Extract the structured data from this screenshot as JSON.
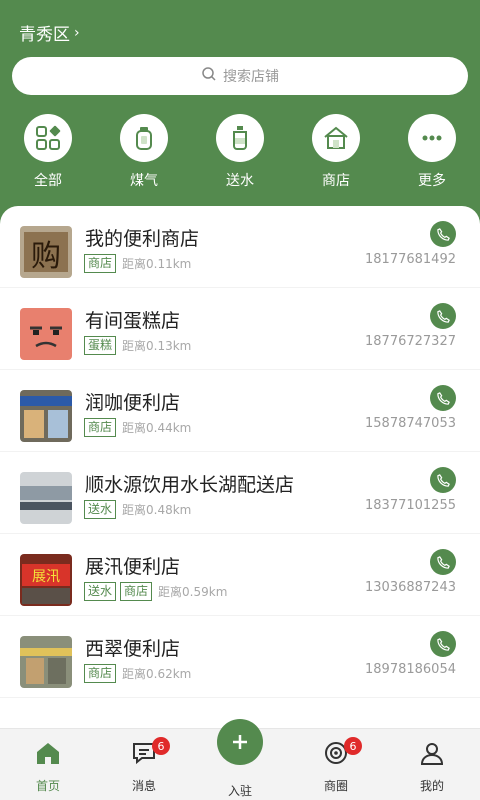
{
  "header": {
    "location": "青秀区"
  },
  "search": {
    "placeholder": "搜索店铺"
  },
  "categories": [
    {
      "label": "全部",
      "icon": "grid-icon"
    },
    {
      "label": "煤气",
      "icon": "gas-cylinder-icon"
    },
    {
      "label": "送水",
      "icon": "water-bucket-icon"
    },
    {
      "label": "商店",
      "icon": "store-icon"
    },
    {
      "label": "更多",
      "icon": "more-icon"
    }
  ],
  "stores": [
    {
      "name": "我的便利商店",
      "tags": [
        "商店"
      ],
      "distance": "距离0.11km",
      "phone": "18177681492"
    },
    {
      "name": "有间蛋糕店",
      "tags": [
        "蛋糕"
      ],
      "distance": "距离0.13km",
      "phone": "18776727327"
    },
    {
      "name": "润咖便利店",
      "tags": [
        "商店"
      ],
      "distance": "距离0.44km",
      "phone": "15878747053"
    },
    {
      "name": "顺水源饮用水长湖配送店",
      "tags": [
        "送水"
      ],
      "distance": "距离0.48km",
      "phone": "18377101255"
    },
    {
      "name": "展汛便利店",
      "tags": [
        "送水",
        "商店"
      ],
      "distance": "距离0.59km",
      "phone": "13036887243"
    },
    {
      "name": "西翠便利店",
      "tags": [
        "商店"
      ],
      "distance": "距离0.62km",
      "phone": "18978186054"
    }
  ],
  "tabbar": [
    {
      "label": "首页",
      "icon": "home-icon",
      "active": true
    },
    {
      "label": "消息",
      "icon": "message-icon",
      "badge": "6"
    },
    {
      "label": "入驻",
      "icon": "plus-icon"
    },
    {
      "label": "商圈",
      "icon": "target-icon",
      "badge": "6"
    },
    {
      "label": "我的",
      "icon": "user-icon"
    }
  ],
  "colors": {
    "brand": "#548a4e",
    "badge": "#e02a2a"
  }
}
